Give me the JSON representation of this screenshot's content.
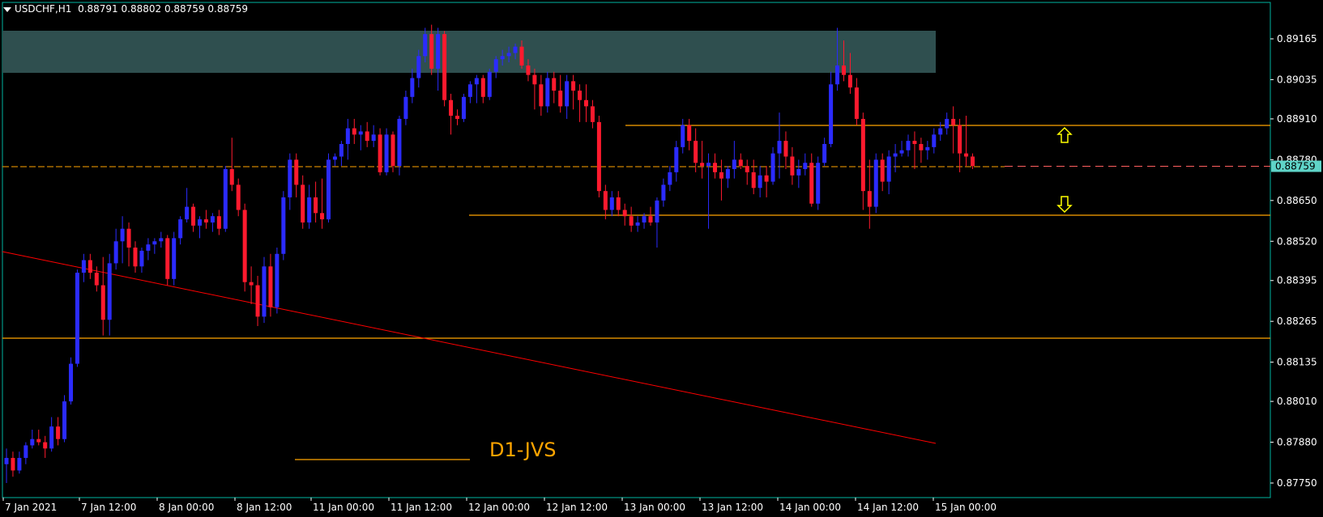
{
  "header": {
    "symbol_timeframe": "USDCHF,H1",
    "ohlc": "0.88791 0.88802 0.88759 0.88759"
  },
  "price_tag": "0.88759",
  "annotation_text": "D1-JVS",
  "colors": {
    "background": "#000000",
    "frame": "#00b3a0",
    "bull_candle": "#2b2bff",
    "bear_candle": "#ff1a2e",
    "zone_fill": "#2f4f4f",
    "level_line": "#ffa500",
    "trend_line": "#ff0000",
    "arrow": "#ffff00",
    "price_tag_bg": "#5fd4c8",
    "axis_text": "#ffffff"
  },
  "chart_data": {
    "type": "candlestick",
    "symbol": "USDCHF",
    "timeframe": "H1",
    "ylim": [
      0.877,
      0.8922
    ],
    "y_ticks": [
      "0.89165",
      "0.89035",
      "0.88910",
      "0.88780",
      "0.88650",
      "0.88520",
      "0.88395",
      "0.88265",
      "0.88135",
      "0.88010",
      "0.87880",
      "0.87750"
    ],
    "x_ticks": [
      "7 Jan 2021",
      "7 Jan 12:00",
      "8 Jan 00:00",
      "8 Jan 12:00",
      "11 Jan 00:00",
      "11 Jan 12:00",
      "12 Jan 00:00",
      "12 Jan 12:00",
      "13 Jan 00:00",
      "13 Jan 12:00",
      "14 Jan 00:00",
      "14 Jan 12:00",
      "15 Jan 00:00"
    ],
    "current_price": 0.88759,
    "ohlc": [
      [
        0.8781,
        0.8786,
        0.8775,
        0.8783
      ],
      [
        0.8783,
        0.8785,
        0.8777,
        0.8779
      ],
      [
        0.8779,
        0.8785,
        0.8778,
        0.8783
      ],
      [
        0.8783,
        0.8788,
        0.8781,
        0.8787
      ],
      [
        0.8787,
        0.8792,
        0.8786,
        0.8789
      ],
      [
        0.8789,
        0.8792,
        0.8787,
        0.8788
      ],
      [
        0.8788,
        0.879,
        0.8783,
        0.8786
      ],
      [
        0.8786,
        0.8796,
        0.8785,
        0.8793
      ],
      [
        0.8793,
        0.8796,
        0.8787,
        0.8789
      ],
      [
        0.8789,
        0.8803,
        0.8788,
        0.8801
      ],
      [
        0.8801,
        0.8815,
        0.88,
        0.8813
      ],
      [
        0.8813,
        0.8843,
        0.8812,
        0.8842
      ],
      [
        0.8842,
        0.8848,
        0.8839,
        0.8846
      ],
      [
        0.8846,
        0.8848,
        0.884,
        0.8842
      ],
      [
        0.8842,
        0.8844,
        0.8836,
        0.8838
      ],
      [
        0.8838,
        0.8847,
        0.8822,
        0.8827
      ],
      [
        0.8827,
        0.8848,
        0.8822,
        0.8845
      ],
      [
        0.8845,
        0.8856,
        0.8843,
        0.8852
      ],
      [
        0.8852,
        0.886,
        0.8845,
        0.8856
      ],
      [
        0.8856,
        0.8858,
        0.8844,
        0.885
      ],
      [
        0.885,
        0.8852,
        0.8842,
        0.8844
      ],
      [
        0.8844,
        0.885,
        0.8842,
        0.8849
      ],
      [
        0.8849,
        0.8853,
        0.8846,
        0.8851
      ],
      [
        0.8851,
        0.8853,
        0.8848,
        0.8852
      ],
      [
        0.8852,
        0.8855,
        0.885,
        0.8853
      ],
      [
        0.8853,
        0.8854,
        0.8838,
        0.884
      ],
      [
        0.884,
        0.8855,
        0.8838,
        0.8853
      ],
      [
        0.8853,
        0.886,
        0.8851,
        0.8859
      ],
      [
        0.8859,
        0.8869,
        0.8858,
        0.8863
      ],
      [
        0.8863,
        0.8864,
        0.8855,
        0.8857
      ],
      [
        0.8857,
        0.886,
        0.8853,
        0.8859
      ],
      [
        0.8859,
        0.8862,
        0.8856,
        0.8858
      ],
      [
        0.8858,
        0.8861,
        0.8855,
        0.886
      ],
      [
        0.886,
        0.8862,
        0.8854,
        0.8856
      ],
      [
        0.8856,
        0.8876,
        0.8855,
        0.8875
      ],
      [
        0.8875,
        0.8885,
        0.8868,
        0.887
      ],
      [
        0.887,
        0.8872,
        0.886,
        0.8862
      ],
      [
        0.8862,
        0.8864,
        0.8836,
        0.8839
      ],
      [
        0.8839,
        0.8844,
        0.8832,
        0.8838
      ],
      [
        0.8838,
        0.8841,
        0.8825,
        0.8828
      ],
      [
        0.8828,
        0.8847,
        0.8826,
        0.8844
      ],
      [
        0.8844,
        0.8848,
        0.8828,
        0.8831
      ],
      [
        0.8831,
        0.885,
        0.8829,
        0.8848
      ],
      [
        0.8848,
        0.8868,
        0.8846,
        0.8866
      ],
      [
        0.8866,
        0.888,
        0.8862,
        0.8878
      ],
      [
        0.8878,
        0.888,
        0.8866,
        0.887
      ],
      [
        0.887,
        0.8873,
        0.8856,
        0.8858
      ],
      [
        0.8858,
        0.887,
        0.8856,
        0.8866
      ],
      [
        0.8866,
        0.8871,
        0.8858,
        0.8861
      ],
      [
        0.8861,
        0.8872,
        0.8856,
        0.8859
      ],
      [
        0.8859,
        0.888,
        0.8858,
        0.8878
      ],
      [
        0.8878,
        0.888,
        0.8876,
        0.8879
      ],
      [
        0.8879,
        0.8884,
        0.8876,
        0.8883
      ],
      [
        0.8883,
        0.8891,
        0.8878,
        0.8888
      ],
      [
        0.8888,
        0.8891,
        0.8883,
        0.8886
      ],
      [
        0.8886,
        0.8889,
        0.8881,
        0.8887
      ],
      [
        0.8887,
        0.889,
        0.8882,
        0.8884
      ],
      [
        0.8884,
        0.8889,
        0.8882,
        0.8886
      ],
      [
        0.8886,
        0.8888,
        0.8873,
        0.8874
      ],
      [
        0.8874,
        0.8888,
        0.8873,
        0.8886
      ],
      [
        0.8886,
        0.8887,
        0.8874,
        0.8876
      ],
      [
        0.8876,
        0.8892,
        0.8873,
        0.8891
      ],
      [
        0.8891,
        0.89,
        0.8889,
        0.8898
      ],
      [
        0.8898,
        0.8907,
        0.8896,
        0.8904
      ],
      [
        0.8904,
        0.8913,
        0.8901,
        0.8911
      ],
      [
        0.8911,
        0.892,
        0.8909,
        0.8918
      ],
      [
        0.8918,
        0.8921,
        0.8905,
        0.8907
      ],
      [
        0.8907,
        0.892,
        0.89,
        0.8918
      ],
      [
        0.8918,
        0.8919,
        0.8895,
        0.8897
      ],
      [
        0.8897,
        0.8899,
        0.8886,
        0.8892
      ],
      [
        0.8892,
        0.8894,
        0.8889,
        0.8891
      ],
      [
        0.8891,
        0.8899,
        0.889,
        0.8898
      ],
      [
        0.8898,
        0.8903,
        0.8896,
        0.8902
      ],
      [
        0.8902,
        0.8905,
        0.8896,
        0.8904
      ],
      [
        0.8904,
        0.8905,
        0.8896,
        0.8898
      ],
      [
        0.8898,
        0.8907,
        0.8897,
        0.8906
      ],
      [
        0.8906,
        0.8911,
        0.8904,
        0.891
      ],
      [
        0.891,
        0.8913,
        0.8908,
        0.8911
      ],
      [
        0.8911,
        0.8914,
        0.8909,
        0.8912
      ],
      [
        0.8912,
        0.8915,
        0.891,
        0.8914
      ],
      [
        0.8914,
        0.8916,
        0.8907,
        0.8908
      ],
      [
        0.8908,
        0.891,
        0.8903,
        0.8905
      ],
      [
        0.8905,
        0.8907,
        0.8894,
        0.8902
      ],
      [
        0.8902,
        0.8905,
        0.8892,
        0.8895
      ],
      [
        0.8895,
        0.8906,
        0.8893,
        0.8904
      ],
      [
        0.8904,
        0.8906,
        0.8896,
        0.89
      ],
      [
        0.89,
        0.8905,
        0.8893,
        0.8895
      ],
      [
        0.8895,
        0.8905,
        0.8891,
        0.8903
      ],
      [
        0.8903,
        0.8905,
        0.8894,
        0.89
      ],
      [
        0.89,
        0.8902,
        0.889,
        0.8897
      ],
      [
        0.8897,
        0.8902,
        0.889,
        0.8895
      ],
      [
        0.8895,
        0.8897,
        0.8888,
        0.889
      ],
      [
        0.889,
        0.8892,
        0.8866,
        0.8868
      ],
      [
        0.8868,
        0.887,
        0.8859,
        0.8862
      ],
      [
        0.8862,
        0.8868,
        0.886,
        0.8866
      ],
      [
        0.8866,
        0.8868,
        0.886,
        0.8862
      ],
      [
        0.8862,
        0.8864,
        0.8857,
        0.886
      ],
      [
        0.886,
        0.8863,
        0.8855,
        0.8857
      ],
      [
        0.8857,
        0.886,
        0.8855,
        0.8858
      ],
      [
        0.8858,
        0.8861,
        0.8856,
        0.886
      ],
      [
        0.886,
        0.8863,
        0.8857,
        0.8858
      ],
      [
        0.8858,
        0.8866,
        0.885,
        0.8865
      ],
      [
        0.8865,
        0.8872,
        0.8863,
        0.887
      ],
      [
        0.887,
        0.8876,
        0.8868,
        0.8874
      ],
      [
        0.8874,
        0.8884,
        0.8871,
        0.8882
      ],
      [
        0.8882,
        0.8891,
        0.888,
        0.8889
      ],
      [
        0.8889,
        0.8891,
        0.8881,
        0.8884
      ],
      [
        0.8884,
        0.8888,
        0.8874,
        0.8877
      ],
      [
        0.8877,
        0.8884,
        0.8872,
        0.8876
      ],
      [
        0.8876,
        0.888,
        0.8856,
        0.8877
      ],
      [
        0.8877,
        0.888,
        0.8872,
        0.8874
      ],
      [
        0.8874,
        0.8878,
        0.8865,
        0.8872
      ],
      [
        0.8872,
        0.8876,
        0.8869,
        0.8875
      ],
      [
        0.8875,
        0.8884,
        0.8872,
        0.8878
      ],
      [
        0.8878,
        0.888,
        0.8875,
        0.8876
      ],
      [
        0.8876,
        0.8878,
        0.887,
        0.8874
      ],
      [
        0.8874,
        0.8878,
        0.8867,
        0.8869
      ],
      [
        0.8869,
        0.8876,
        0.8866,
        0.8873
      ],
      [
        0.8873,
        0.8876,
        0.8866,
        0.8871
      ],
      [
        0.8871,
        0.8882,
        0.887,
        0.888
      ],
      [
        0.888,
        0.8893,
        0.8872,
        0.8884
      ],
      [
        0.8884,
        0.8887,
        0.8875,
        0.8879
      ],
      [
        0.8879,
        0.8882,
        0.887,
        0.8873
      ],
      [
        0.8873,
        0.8878,
        0.8869,
        0.8875
      ],
      [
        0.8875,
        0.888,
        0.8873,
        0.8877
      ],
      [
        0.8877,
        0.888,
        0.8863,
        0.8864
      ],
      [
        0.8864,
        0.8879,
        0.8862,
        0.8877
      ],
      [
        0.8877,
        0.8885,
        0.8876,
        0.8883
      ],
      [
        0.8883,
        0.8906,
        0.8882,
        0.8902
      ],
      [
        0.8902,
        0.892,
        0.89,
        0.8908
      ],
      [
        0.8908,
        0.8916,
        0.8903,
        0.8905
      ],
      [
        0.8905,
        0.8912,
        0.8899,
        0.8901
      ],
      [
        0.8901,
        0.8904,
        0.8889,
        0.8891
      ],
      [
        0.8891,
        0.8893,
        0.8862,
        0.8868
      ],
      [
        0.8868,
        0.8878,
        0.8856,
        0.8863
      ],
      [
        0.8863,
        0.888,
        0.8861,
        0.8878
      ],
      [
        0.8878,
        0.888,
        0.8868,
        0.8871
      ],
      [
        0.8871,
        0.8881,
        0.8867,
        0.8879
      ],
      [
        0.8879,
        0.8883,
        0.8874,
        0.888
      ],
      [
        0.888,
        0.8884,
        0.8879,
        0.8881
      ],
      [
        0.8881,
        0.8886,
        0.8879,
        0.8884
      ],
      [
        0.8884,
        0.8887,
        0.8875,
        0.8883
      ],
      [
        0.8883,
        0.8885,
        0.8877,
        0.8881
      ],
      [
        0.8881,
        0.8884,
        0.8878,
        0.8882
      ],
      [
        0.8882,
        0.8888,
        0.888,
        0.8886
      ],
      [
        0.8886,
        0.889,
        0.8884,
        0.8888
      ],
      [
        0.8888,
        0.8893,
        0.8886,
        0.8891
      ],
      [
        0.8891,
        0.8895,
        0.888,
        0.8889
      ],
      [
        0.8889,
        0.8891,
        0.8874,
        0.888
      ],
      [
        0.888,
        0.8892,
        0.8876,
        0.8879
      ],
      [
        0.8879,
        0.888,
        0.8875,
        0.8876
      ]
    ]
  }
}
